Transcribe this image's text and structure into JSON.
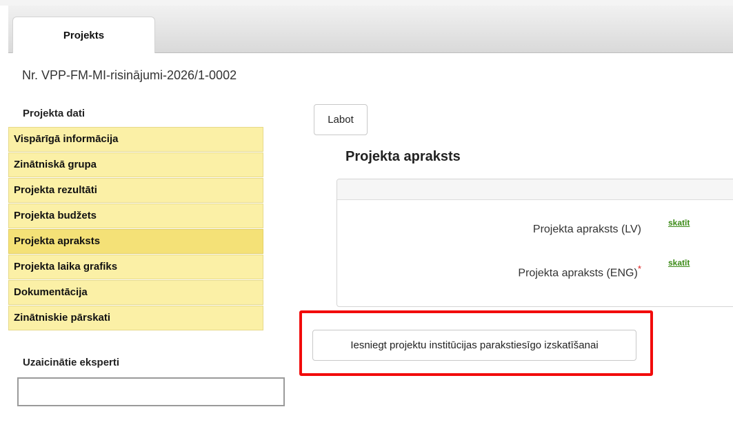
{
  "tabs": [
    {
      "label": "Projekts",
      "active": true
    }
  ],
  "project": {
    "number": "Nr. VPP-FM-MI-risinājumi-2026/1-0002"
  },
  "sidebar": {
    "section_title": "Projekta dati",
    "items": [
      {
        "label": "Vispārīgā informācija",
        "active": false
      },
      {
        "label": "Zinātniskā grupa",
        "active": false
      },
      {
        "label": "Projekta rezultāti",
        "active": false
      },
      {
        "label": "Projekta budžets",
        "active": false
      },
      {
        "label": "Projekta apraksts",
        "active": true
      },
      {
        "label": "Projekta laika grafiks",
        "active": false
      },
      {
        "label": "Dokumentācija",
        "active": false
      },
      {
        "label": "Zinātniskie pārskati",
        "active": false
      }
    ],
    "experts_label": "Uzaicinātie eksperti",
    "experts_value": ""
  },
  "main": {
    "edit_button": "Labot",
    "title": "Projekta apraksts",
    "fields": [
      {
        "label": "Projekta apraksts (LV)",
        "required": false,
        "link": "skatīt"
      },
      {
        "label": "Projekta apraksts (ENG)",
        "required": true,
        "required_mark": "*",
        "link": "skatīt"
      }
    ],
    "submit_button": "Iesniegt projektu institūcijas parakstiesīgo izskatīšanai"
  },
  "colors": {
    "nav_bg": "#fbf0a6",
    "nav_active_bg": "#f4e177",
    "link": "#3a8a15",
    "highlight": "#f20b0b",
    "required": "#d22222"
  }
}
